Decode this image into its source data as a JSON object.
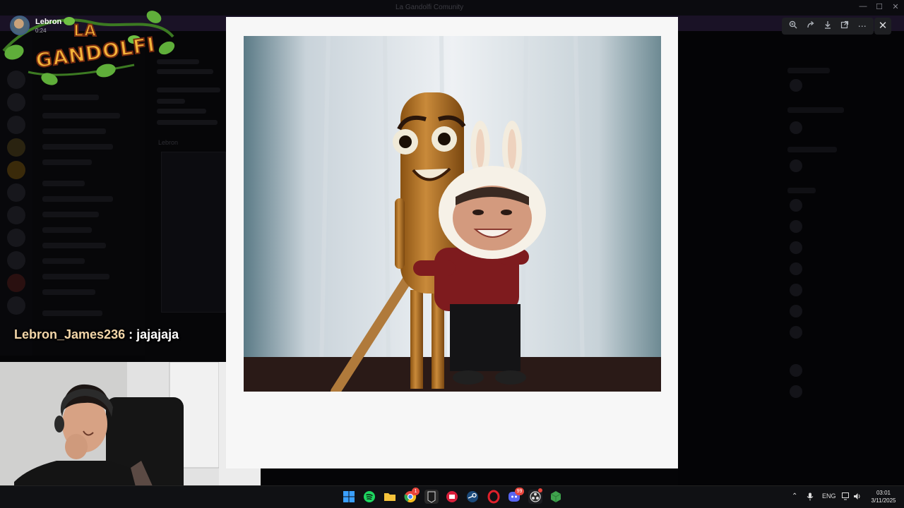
{
  "speaker": {
    "name": "Lebron",
    "duration": "0:24"
  },
  "logo": {
    "line1": "LA",
    "line2": "GANDOLFI"
  },
  "chat": {
    "user": "Lebron_James236",
    "separator": " : ",
    "message": "jajajaja"
  },
  "viewer": {
    "toolbar": {
      "zoom_icon": "zoom-in-icon",
      "forward_icon": "forward-icon",
      "download_icon": "download-icon",
      "open_icon": "open-external-icon",
      "more_icon": "more-icon"
    },
    "close_icon": "close-icon"
  },
  "background": {
    "window_title": "La Gandolfi Comunity",
    "partial_user": "Lebron"
  },
  "taskbar": {
    "apps": [
      "windows-start",
      "spotify",
      "file-explorer",
      "chrome",
      "epic-games",
      "app-red",
      "steam",
      "opera",
      "discord",
      "obs",
      "app-green"
    ],
    "badges": {
      "chrome": "1",
      "discord": "99"
    },
    "tray": {
      "language": "ENG"
    },
    "clock": {
      "time": "03:01",
      "date": "3/11/2025"
    }
  },
  "colors": {
    "accent": "#5865f2",
    "logo_fill": "#f4b43a",
    "logo_outline": "#7a2d10",
    "vine": "#5fae3a"
  }
}
